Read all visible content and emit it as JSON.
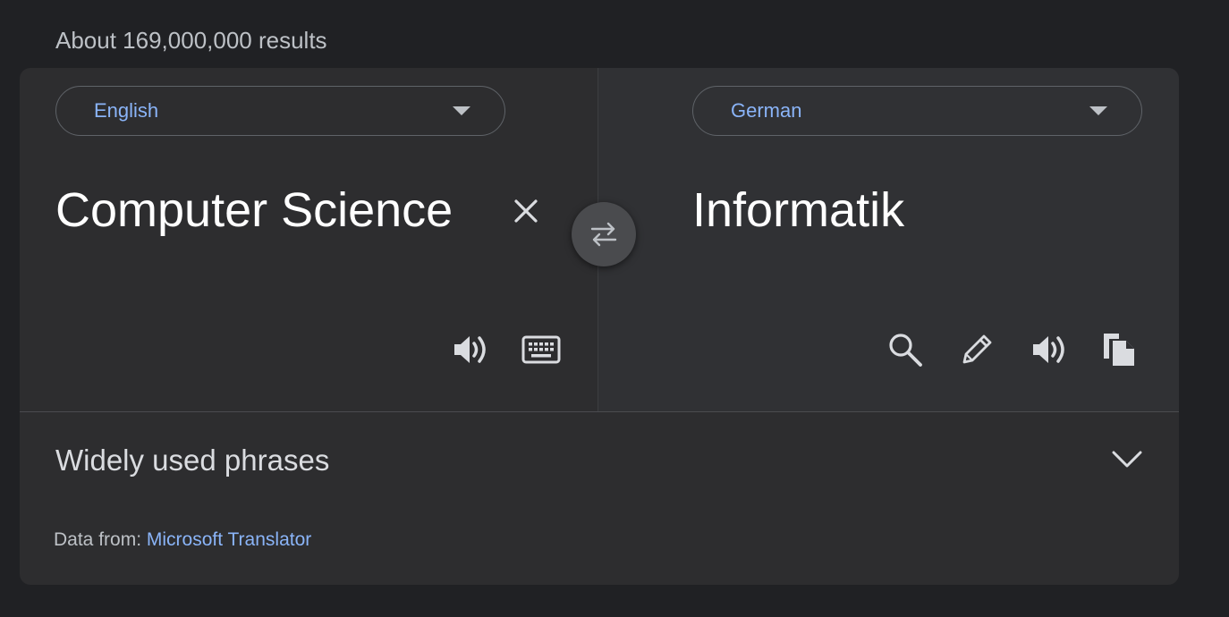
{
  "results_text": "About 169,000,000 results",
  "source_lang": {
    "label": "English",
    "text": "Computer Science"
  },
  "target_lang": {
    "label": "German",
    "text": "Informatik"
  },
  "phrases_label": "Widely used phrases",
  "source_prefix": "Data from:",
  "source_link": "Microsoft Translator",
  "colors": {
    "accent": "#8ab4f8",
    "background": "#202124",
    "card": "#2d2d2f"
  },
  "icons": [
    "close-icon",
    "swap-icon",
    "speaker-icon",
    "keyboard-icon",
    "search-icon",
    "pencil-icon",
    "copy-icon",
    "chevron-down-icon",
    "caret-down-icon"
  ]
}
